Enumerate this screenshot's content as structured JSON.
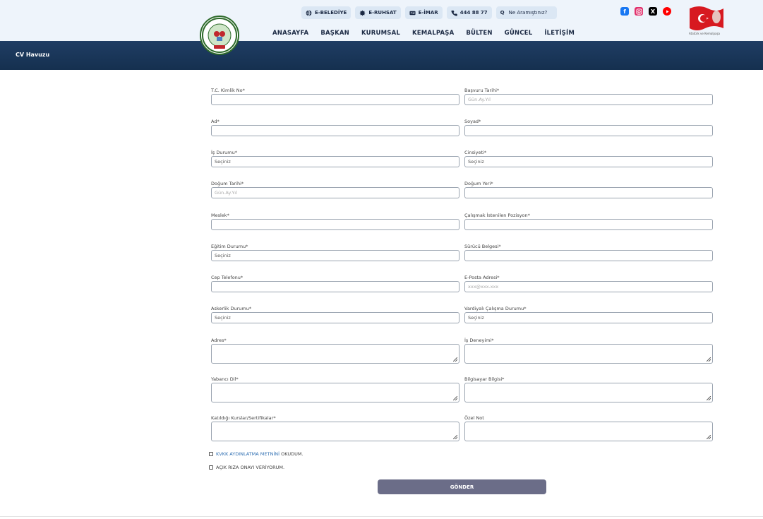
{
  "header": {
    "quick_links": [
      {
        "label": "E-BELEDİYE",
        "icon": "globe-icon"
      },
      {
        "label": "E-RUHSAT",
        "icon": "badge-icon"
      },
      {
        "label": "E-İMAR",
        "icon": "id-card-icon"
      },
      {
        "label": "444 88 77",
        "icon": "phone-icon"
      }
    ],
    "search_placeholder": "Ne Aramıştınız?",
    "nav": [
      "ANASAYFA",
      "BAŞKAN",
      "KURUMSAL",
      "KEMALPAŞA",
      "BÜLTEN",
      "GÜNCEL",
      "İLETİŞİM"
    ],
    "social": [
      "facebook-icon",
      "instagram-icon",
      "x-icon",
      "youtube-icon"
    ],
    "flag_caption": "Atatürk ve Kemalpaşa",
    "colors": {
      "facebook": "#1877f2",
      "instagram": "#e1306c",
      "x": "#000000",
      "youtube": "#ff0000"
    }
  },
  "banner": {
    "title": "CV Havuzu"
  },
  "form": {
    "tc": {
      "label": "T.C. Kimlik No*",
      "value": ""
    },
    "basvuru": {
      "label": "Başvuru Tarihi*",
      "placeholder": "Gün.Ay.Yıl"
    },
    "ad": {
      "label": "Ad*",
      "value": ""
    },
    "soyad": {
      "label": "Soyad*",
      "value": ""
    },
    "is_durumu": {
      "label": "İş Durumu*",
      "value": "Seçiniz"
    },
    "cinsiyet": {
      "label": "Cinsiyeti*",
      "value": "Seçiniz"
    },
    "dogum_tarihi": {
      "label": "Doğum Tarihi*",
      "placeholder": "Gün.Ay.Yıl"
    },
    "dogum_yeri": {
      "label": "Doğum Yeri*",
      "value": ""
    },
    "meslek": {
      "label": "Meslek*",
      "value": ""
    },
    "pozisyon": {
      "label": "Çalışmak İstenilen Pozisyon*",
      "value": ""
    },
    "egitim": {
      "label": "Eğitim Durumu*",
      "value": "Seçiniz"
    },
    "surucu": {
      "label": "Sürücü Belgesi*",
      "value": ""
    },
    "cep": {
      "label": "Cep Telefonu*",
      "value": ""
    },
    "eposta": {
      "label": "E-Posta Adresi*",
      "placeholder": "xxx@xxx.xxx"
    },
    "askerlik": {
      "label": "Askerlik Durumu*",
      "value": "Seçiniz"
    },
    "vardiya": {
      "label": "Vardiyalı Çalışma Durumu*",
      "value": "Seçiniz"
    },
    "adres": {
      "label": "Adres*"
    },
    "is_deneyimi": {
      "label": "İş Deneyimi*"
    },
    "yabanci_dil": {
      "label": "Yabancı Dil*"
    },
    "bilgisayar": {
      "label": "Bilgisayar Bilgisi*"
    },
    "kurslar": {
      "label": "Katıldığı Kurslar/Sertifikalar*"
    },
    "ozel_not": {
      "label": "Özel Not"
    },
    "kvkk_link": "KVKK AYDINLATMA METNİNİ",
    "kvkk_suffix": " OKUDUM.",
    "riza": "AÇIK RIZA ONAYI VERİYORUM.",
    "submit": "GÖNDER"
  }
}
